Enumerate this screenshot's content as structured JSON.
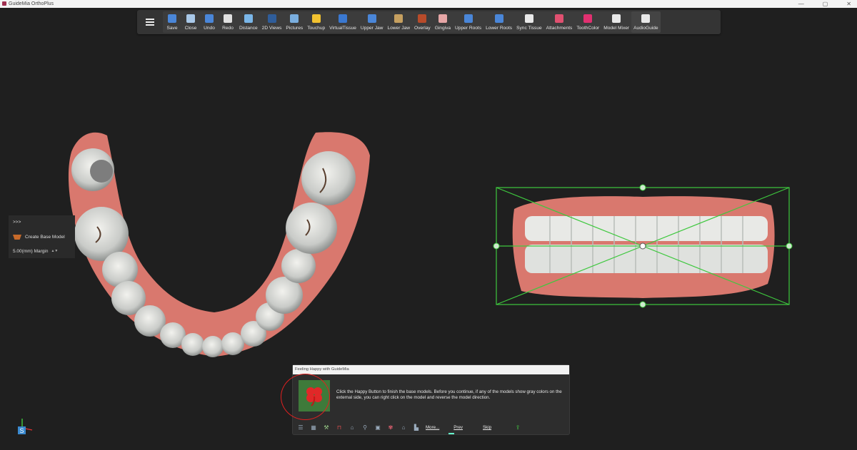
{
  "window": {
    "title": "GuideMia OrthoPlus",
    "buttons": [
      "—",
      "▢",
      "✕"
    ]
  },
  "toolbar": {
    "items": [
      {
        "label": "Save",
        "icon": "save-icon",
        "color": "#4a86d8"
      },
      {
        "label": "Close",
        "icon": "close-file-icon",
        "color": "#a9c8e8"
      },
      {
        "label": "Undo",
        "icon": "undo-icon",
        "color": "#4a86d8"
      },
      {
        "label": "Redo",
        "icon": "redo-icon",
        "color": "#e0e0e0"
      },
      {
        "label": "Distance",
        "icon": "ruler-icon",
        "color": "#7ab6e8"
      },
      {
        "label": "2D Views",
        "icon": "2d-views-icon",
        "color": "#2f5d9a"
      },
      {
        "label": "Pictures",
        "icon": "pictures-icon",
        "color": "#7aaede"
      },
      {
        "label": "Touchup",
        "icon": "touchup-icon",
        "color": "#f2c230"
      },
      {
        "label": "VirtualTissue",
        "icon": "virtual-tissue-icon",
        "color": "#3a78d0"
      },
      {
        "label": "Upper Jaw",
        "icon": "upper-jaw-icon",
        "color": "#4a86d8"
      },
      {
        "label": "Lower Jaw",
        "icon": "lower-jaw-icon",
        "color": "#c6a060"
      },
      {
        "label": "Overlay",
        "icon": "overlay-icon",
        "color": "#b84b2a"
      },
      {
        "label": "Gingiva",
        "icon": "gingiva-icon",
        "color": "#e6a6a6"
      },
      {
        "label": "Upper Roots",
        "icon": "upper-roots-icon",
        "color": "#4a86d8"
      },
      {
        "label": "Lower Roots",
        "icon": "lower-roots-icon",
        "color": "#4a86d8"
      },
      {
        "label": "Sync Tissue",
        "icon": "sync-tissue-icon",
        "color": "#e8e8e8"
      },
      {
        "label": "Attachments",
        "icon": "attachments-icon",
        "color": "#e05070"
      },
      {
        "label": "ToothColor",
        "icon": "tooth-color-icon",
        "color": "#e03070"
      },
      {
        "label": "Model Mixer",
        "icon": "cube-icon",
        "color": "#e8e8e8"
      },
      {
        "label": "AudioGuide",
        "icon": "audio-guide-icon",
        "color": "#e8e8e8"
      }
    ]
  },
  "sidepanel": {
    "expand_label": ">>>",
    "create_label": "Create Base Model",
    "margin_label": "5.00(mm) Margin"
  },
  "dialog": {
    "title": "Feeling Happy with GuideMia",
    "message": "Click the Happy Button to finish the base models. Before you continue, if any of the models show gray colors on the external side, you can right click on the model and reverse the model direction.",
    "more_label": "More...",
    "prev_label": "Prev",
    "skip_label": "Skip"
  },
  "axis": {
    "label": "S"
  },
  "colors": {
    "accent": "#4a86d8",
    "selection": "#3ec83e",
    "highlight_ring": "#e02020"
  }
}
